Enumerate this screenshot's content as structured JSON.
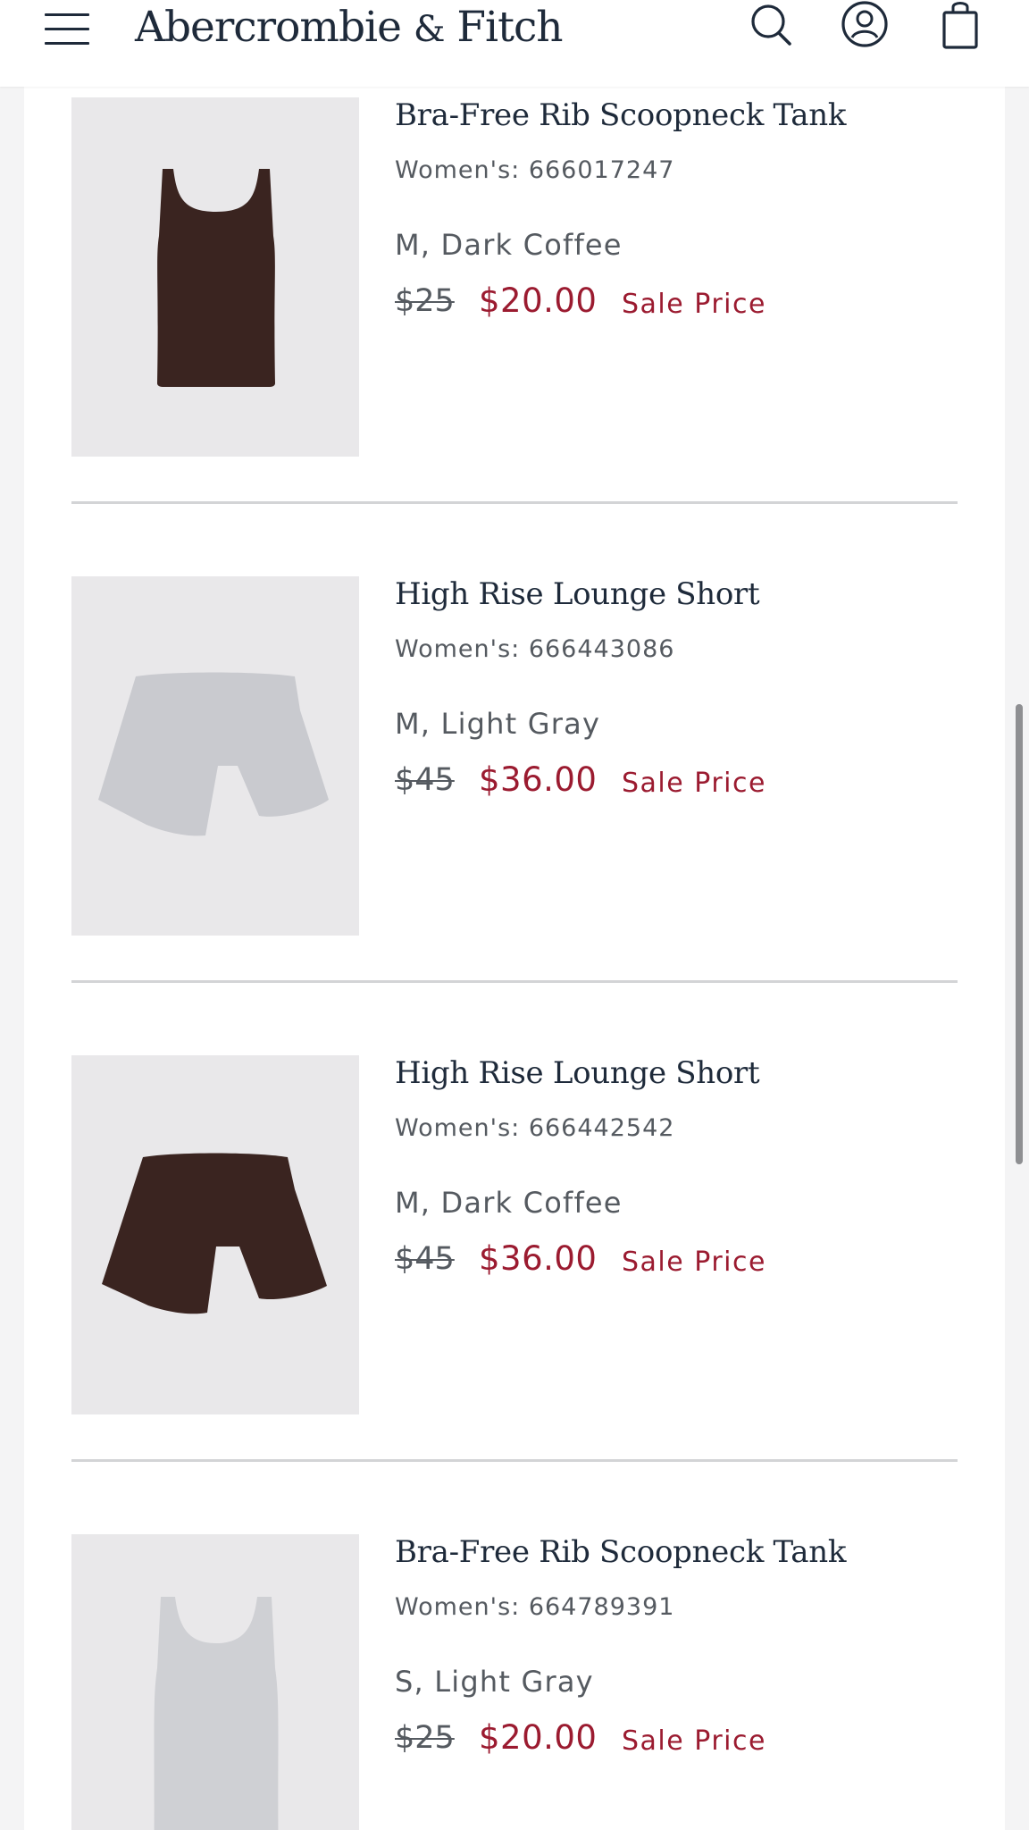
{
  "header": {
    "brand_main": "Abercrombie",
    "brand_amp": "&",
    "brand_tail": "Fitch",
    "menu_icon": "hamburger-menu-icon",
    "search_icon": "search-icon",
    "account_icon": "account-icon",
    "bag_icon": "shopping-bag-icon"
  },
  "products": [
    {
      "name": "Bra-Free Rib Scoopneck Tank",
      "sku": "Women's: 666017247",
      "variant": "M, Dark Coffee",
      "original_price": "$25",
      "sale_price": "$20.00",
      "sale_label": "Sale Price",
      "image_color": "#3a2420"
    },
    {
      "name": "High Rise Lounge Short",
      "sku": "Women's: 666443086",
      "variant": "M, Light Gray",
      "original_price": "$45",
      "sale_price": "$36.00",
      "sale_label": "Sale Price",
      "image_color": "#c9cacf"
    },
    {
      "name": "High Rise Lounge Short",
      "sku": "Women's: 666442542",
      "variant": "M, Dark Coffee",
      "original_price": "$45",
      "sale_price": "$36.00",
      "sale_label": "Sale Price",
      "image_color": "#3a2420"
    },
    {
      "name": "Bra-Free Rib Scoopneck Tank",
      "sku": "Women's: 664789391",
      "variant": "S, Light Gray",
      "original_price": "$25",
      "sale_price": "$20.00",
      "sale_label": "Sale Price",
      "image_color": "#cfd0d4"
    }
  ],
  "colors": {
    "brand_text": "#1e2a3a",
    "sale_red": "#9b1b30",
    "muted_text": "#555a60",
    "thumb_bg": "#e9e8ea",
    "divider": "#d3d4d6"
  }
}
